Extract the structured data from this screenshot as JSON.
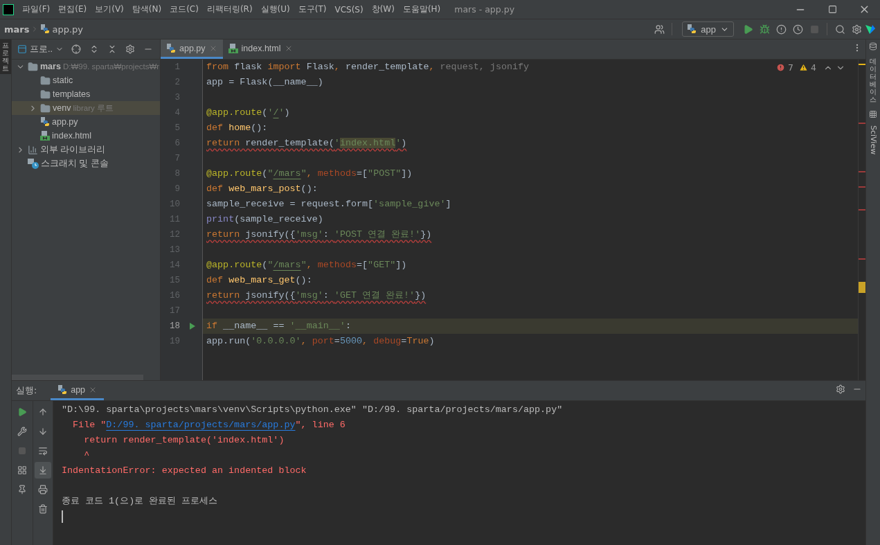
{
  "window": {
    "title": "mars - app.py"
  },
  "menu": [
    "파일(F)",
    "편집(E)",
    "보기(V)",
    "탐색(N)",
    "코드(C)",
    "리팩터링(R)",
    "실행(U)",
    "도구(T)",
    "VCS(S)",
    "창(W)",
    "도움말(H)"
  ],
  "breadcrumb": [
    {
      "label": "mars",
      "kind": "folder"
    },
    {
      "label": "app.py",
      "kind": "python"
    }
  ],
  "toolbar": {
    "run_config": "app"
  },
  "left_strip": {
    "label": "프로젝트"
  },
  "right_strip": [
    "데이터베이스",
    "SciView"
  ],
  "project": {
    "title": "프로..",
    "tree": [
      {
        "label": "mars",
        "hint": "D:₩99. sparta₩projects₩r",
        "kind": "folder",
        "expanded": true,
        "selected": false,
        "children": [
          {
            "label": "static",
            "kind": "folder",
            "selected": false
          },
          {
            "label": "templates",
            "kind": "folder",
            "selected": false
          },
          {
            "label": "venv",
            "hint": "library 루트",
            "kind": "folder",
            "expanded": false,
            "selected": true
          },
          {
            "label": "app.py",
            "kind": "python",
            "selected": false
          },
          {
            "label": "index.html",
            "kind": "html",
            "selected": false
          }
        ]
      },
      {
        "label": "외부 라이브러리",
        "kind": "library",
        "expanded": false,
        "selected": false
      },
      {
        "label": "스크래치 및 콘솔",
        "kind": "scratch",
        "selected": false
      }
    ]
  },
  "editor_tabs": [
    {
      "label": "app.py",
      "kind": "python",
      "selected": true
    },
    {
      "label": "index.html",
      "kind": "html",
      "selected": false
    }
  ],
  "inspections": {
    "errors": "7",
    "warnings": "4"
  },
  "code": [
    {
      "number": "1",
      "highlighted": false,
      "run": false,
      "error": false,
      "tokens": [
        {
          "text": "from",
          "kind": "kw"
        },
        {
          "text": " flask ",
          "kind": "plain"
        },
        {
          "text": "import",
          "kind": "kw"
        },
        {
          "text": " Flask",
          "kind": "plain"
        },
        {
          "text": ", ",
          "kind": "kw"
        },
        {
          "text": "render_template",
          "kind": "plain"
        },
        {
          "text": ", ",
          "kind": "kw"
        },
        {
          "text": "request, jsonify",
          "kind": "dim"
        }
      ]
    },
    {
      "number": "2",
      "highlighted": false,
      "run": false,
      "error": false,
      "tokens": [
        {
          "text": "app = Flask(__name__)",
          "kind": "plain"
        }
      ]
    },
    {
      "number": "3",
      "highlighted": false,
      "run": false
    },
    {
      "number": "4",
      "highlighted": false,
      "run": false,
      "error": false,
      "tokens": [
        {
          "text": "@app.route",
          "kind": "dec"
        },
        {
          "text": "(",
          "kind": "plain"
        },
        {
          "text": "'",
          "kind": "str"
        },
        {
          "text": "/",
          "kind": "link"
        },
        {
          "text": "'",
          "kind": "str"
        },
        {
          "text": ")",
          "kind": "plain"
        }
      ]
    },
    {
      "number": "5",
      "highlighted": false,
      "run": false,
      "error": false,
      "tokens": [
        {
          "text": "def",
          "kind": "kw"
        },
        {
          "text": " home",
          "kind": "fn"
        },
        {
          "text": "():",
          "kind": "plain"
        }
      ]
    },
    {
      "number": "6",
      "highlighted": false,
      "run": false,
      "error": true,
      "tokens": [
        {
          "text": "return",
          "kind": "kw"
        },
        {
          "text": " render_template(",
          "kind": "plain"
        },
        {
          "text": "'",
          "kind": "str"
        },
        {
          "text": "index.html",
          "kind": "match"
        },
        {
          "text": "'",
          "kind": "str"
        },
        {
          "text": ")",
          "kind": "plain"
        }
      ]
    },
    {
      "number": "7",
      "highlighted": false,
      "run": false
    },
    {
      "number": "8",
      "highlighted": false,
      "run": false,
      "error": false,
      "tokens": [
        {
          "text": "@app.route",
          "kind": "dec"
        },
        {
          "text": "(",
          "kind": "plain"
        },
        {
          "text": "\"",
          "kind": "str"
        },
        {
          "text": "/mars",
          "kind": "link"
        },
        {
          "text": "\"",
          "kind": "str"
        },
        {
          "text": ", ",
          "kind": "kw"
        },
        {
          "text": "methods",
          "kind": "param"
        },
        {
          "text": "=[",
          "kind": "plain"
        },
        {
          "text": "\"POST\"",
          "kind": "str"
        },
        {
          "text": "])",
          "kind": "plain"
        }
      ]
    },
    {
      "number": "9",
      "highlighted": false,
      "run": false,
      "error": false,
      "tokens": [
        {
          "text": "def",
          "kind": "kw"
        },
        {
          "text": " web_mars_post",
          "kind": "fn"
        },
        {
          "text": "():",
          "kind": "plain"
        }
      ]
    },
    {
      "number": "10",
      "highlighted": false,
      "run": false,
      "error": false,
      "tokens": [
        {
          "text": "sample_receive = request.form[",
          "kind": "plain"
        },
        {
          "text": "'sample_give'",
          "kind": "str"
        },
        {
          "text": "]",
          "kind": "plain"
        }
      ]
    },
    {
      "number": "11",
      "highlighted": false,
      "run": false,
      "error": false,
      "tokens": [
        {
          "text": "print",
          "kind": "builtin"
        },
        {
          "text": "(sample_receive)",
          "kind": "plain"
        }
      ]
    },
    {
      "number": "12",
      "highlighted": false,
      "run": false,
      "error": true,
      "tokens": [
        {
          "text": "return",
          "kind": "kw"
        },
        {
          "text": " jsonify({",
          "kind": "plain"
        },
        {
          "text": "'msg'",
          "kind": "str"
        },
        {
          "text": ": ",
          "kind": "plain"
        },
        {
          "text": "'POST 연결 완료!'",
          "kind": "str"
        },
        {
          "text": "})",
          "kind": "plain"
        }
      ]
    },
    {
      "number": "13",
      "highlighted": false,
      "run": false
    },
    {
      "number": "14",
      "highlighted": false,
      "run": false,
      "error": false,
      "tokens": [
        {
          "text": "@app.route",
          "kind": "dec"
        },
        {
          "text": "(",
          "kind": "plain"
        },
        {
          "text": "\"",
          "kind": "str"
        },
        {
          "text": "/mars",
          "kind": "link"
        },
        {
          "text": "\"",
          "kind": "str"
        },
        {
          "text": ", ",
          "kind": "kw"
        },
        {
          "text": "methods",
          "kind": "param"
        },
        {
          "text": "=[",
          "kind": "plain"
        },
        {
          "text": "\"GET\"",
          "kind": "str"
        },
        {
          "text": "])",
          "kind": "plain"
        }
      ]
    },
    {
      "number": "15",
      "highlighted": false,
      "run": false,
      "error": false,
      "tokens": [
        {
          "text": "def",
          "kind": "kw"
        },
        {
          "text": " web_mars_get",
          "kind": "fn"
        },
        {
          "text": "():",
          "kind": "plain"
        }
      ]
    },
    {
      "number": "16",
      "highlighted": false,
      "run": false,
      "error": true,
      "tokens": [
        {
          "text": "return",
          "kind": "kw"
        },
        {
          "text": " jsonify({",
          "kind": "plain"
        },
        {
          "text": "'msg'",
          "kind": "str"
        },
        {
          "text": ": ",
          "kind": "plain"
        },
        {
          "text": "'GET 연결 완료!'",
          "kind": "str"
        },
        {
          "text": "})",
          "kind": "plain"
        }
      ]
    },
    {
      "number": "17",
      "highlighted": false,
      "run": false
    },
    {
      "number": "18",
      "highlighted": true,
      "run": true,
      "error": false,
      "tokens": [
        {
          "text": "if",
          "kind": "kw"
        },
        {
          "text": " __name__ == ",
          "kind": "plain"
        },
        {
          "text": "'__main__'",
          "kind": "str"
        },
        {
          "text": ":",
          "kind": "plain"
        }
      ]
    },
    {
      "number": "19",
      "highlighted": false,
      "run": false,
      "error": false,
      "tokens": [
        {
          "text": "app.run(",
          "kind": "plain"
        },
        {
          "text": "'0.0.0.0'",
          "kind": "str"
        },
        {
          "text": ", ",
          "kind": "kw"
        },
        {
          "text": "port",
          "kind": "param"
        },
        {
          "text": "=",
          "kind": "plain"
        },
        {
          "text": "5000",
          "kind": "num"
        },
        {
          "text": ", ",
          "kind": "kw"
        },
        {
          "text": "debug",
          "kind": "param"
        },
        {
          "text": "=",
          "kind": "plain"
        },
        {
          "text": "True",
          "kind": "kw"
        },
        {
          "text": ")",
          "kind": "plain"
        }
      ]
    }
  ],
  "run_panel": {
    "label": "실행:",
    "tabs": [
      {
        "label": "app",
        "selected": true
      }
    ],
    "console": [
      {
        "kind": "text",
        "segments": [
          {
            "text": "\"D:\\99. sparta\\projects\\mars\\venv\\Scripts\\python.exe\" \"D:/99. sparta/projects/mars/app.py\"",
            "kind": "plain"
          }
        ]
      },
      {
        "kind": "text",
        "segments": [
          {
            "text": "  File \"",
            "kind": "err"
          },
          {
            "text": "D:/99. sparta/projects/mars/app.py",
            "kind": "link"
          },
          {
            "text": "\", line 6",
            "kind": "err"
          }
        ]
      },
      {
        "kind": "text",
        "segments": [
          {
            "text": "    return render_template('index.html')",
            "kind": "err"
          }
        ]
      },
      {
        "kind": "text",
        "segments": [
          {
            "text": "    ^",
            "kind": "err"
          }
        ]
      },
      {
        "kind": "text",
        "segments": [
          {
            "text": "IndentationError: expected an indented block",
            "kind": "err"
          }
        ]
      },
      {
        "kind": "blank"
      },
      {
        "kind": "text",
        "segments": [
          {
            "text": "종료 코드 1(으)로 완료된 프로세스",
            "kind": "plain"
          }
        ]
      },
      {
        "kind": "cursor"
      }
    ]
  }
}
